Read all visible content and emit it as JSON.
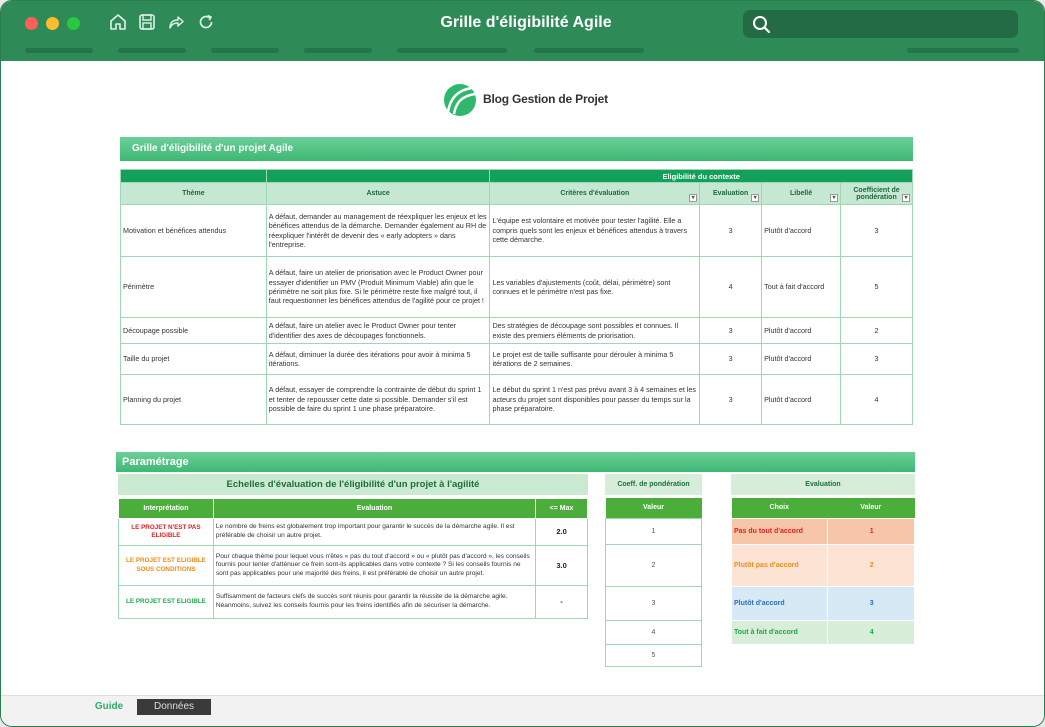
{
  "window": {
    "title": "Grille d'éligibilité Agile",
    "toolbar_icons": [
      "home-icon",
      "save-icon",
      "redo-icon",
      "refresh-icon"
    ],
    "search_placeholder": ""
  },
  "logo": {
    "text": "Blog Gestion de Projet"
  },
  "section1": {
    "title": "Grille d'éligibilité d'un projet Agile",
    "group_header": "Eligibilité du contexte",
    "columns": [
      "Thème",
      "Astuce",
      "Critères d'évaluation",
      "Evaluation",
      "Libellé",
      "Coefficient de pondération"
    ],
    "rows": [
      {
        "theme": "Motivation et bénéfices attendus",
        "astuce": "A défaut, demander au management de réexpliquer les enjeux et les bénéfices attendus de la démarche. Demander également au RH de réexpliquer l'intérêt de devenir des « early adopters » dans l'entreprise.",
        "critere": "L'équipe est volontaire et motivée pour tester l'agilité. Elle a compris quels sont les enjeux et bénéfices attendus à travers cette démarche.",
        "evaluation": "3",
        "libelle": "Plutôt d'accord",
        "coef": "3"
      },
      {
        "theme": "Périmètre",
        "astuce": "A défaut, faire un atelier de priorisation avec le Product Owner pour essayer d'identifier un PMV (Produit Minimum Viable) afin que le périmètre ne soit plus fixe. Si le périmètre reste fixe malgré tout, il faut requestionner les bénéfices attendus de l'agilité pour ce projet !",
        "critere": "Les variables d'ajustements (coût, délai, périmètre) sont connues et le périmètre n'est pas fixe.",
        "evaluation": "4",
        "libelle": "Tout à fait d'accord",
        "coef": "5"
      },
      {
        "theme": "Découpage possible",
        "astuce": "A défaut, faire un atelier avec le Product Owner pour tenter d'identifier des axes de découpages fonctionnels.",
        "critere": "Des stratégies de découpage sont possibles et connues. Il existe des premiers éléments de priorisation.",
        "evaluation": "3",
        "libelle": "Plutôt d'accord",
        "coef": "2"
      },
      {
        "theme": "Taille du projet",
        "astuce": "A défaut, diminuer la durée des itérations pour avoir à minima 5 itérations.",
        "critere": "Le projet est de taille suffisante pour dérouler à minima 5 itérations de 2 semaines.",
        "evaluation": "3",
        "libelle": "Plutôt d'accord",
        "coef": "3"
      },
      {
        "theme": "Planning du projet",
        "astuce": "A défaut, essayer de comprendre la contrainte de début du sprint 1 et tenter de repousser cette date si possible. Demander s'il est possible de faire du sprint 1 une phase préparatoire.",
        "critere": "Le début du sprint 1 n'est pas prévu avant 3 à 4 semaines et les acteurs du projet sont disponibles pour passer du temps sur la phase préparatoire.",
        "evaluation": "3",
        "libelle": "Plutôt d'accord",
        "coef": "4"
      }
    ]
  },
  "parametrage": {
    "title": "Paramétrage",
    "scales": {
      "title": "Echelles d'évaluation de l'éligibilité d'un projet à l'agilité",
      "columns": [
        "Interprétation",
        "Evaluation",
        "<= Max"
      ],
      "rows": [
        {
          "interpretation": "LE PROJET N'EST PAS ELIGIBLE",
          "color": "#e02020",
          "evaluation": "Le nombre de freins est globalement trop important pour garantir le succès de la démarche agile. Il est préférable de choisir un autre projet.",
          "max": "2.0"
        },
        {
          "interpretation": "LE PROJET EST ELIGIBLE SOUS CONDITIONS",
          "color": "#f08c1a",
          "evaluation": "Pour chaque thème pour lequel vous n'êtes « pas du tout d'accord » ou « plutôt pas d'accord », les conseils fournis pour tenter d'atténuer ce frein sont-ils applicables dans votre contexte ? Si les conseils fournis ne sont pas applicables pour une majorité des freins, il est préférable de choisir un autre projet.",
          "max": "3.0"
        },
        {
          "interpretation": "LE PROJET EST ELIGIBLE",
          "color": "#1fa84a",
          "evaluation": "Suffisamment de facteurs clefs de succès sont réunis pour garantir la réussite de la démarche agile. Néanmoins, suivez les conseils fournis pour les freins identifiés afin de sécuriser la démarche.",
          "max": "-"
        }
      ]
    },
    "coef": {
      "title": "Coeff. de pondération",
      "column": "Valeur",
      "values": [
        "1",
        "2",
        "3",
        "4",
        "5"
      ]
    },
    "evaluation": {
      "title": "Evaluation",
      "columns": [
        "Choix",
        "Valeur"
      ],
      "rows": [
        {
          "choix": "Pas du tout d'accord",
          "valeur": "1",
          "bg": "#f7c6a8",
          "color": "#e02020"
        },
        {
          "choix": "Plutôt pas d'accord",
          "valeur": "2",
          "bg": "#fde3d3",
          "color": "#f08c1a"
        },
        {
          "choix": "Plutôt d'accord",
          "valeur": "3",
          "bg": "#d6e9f5",
          "color": "#2a6fbf"
        },
        {
          "choix": "Tout à fait d'accord",
          "valeur": "4",
          "bg": "#d9eed9",
          "color": "#1fa84a"
        }
      ]
    }
  },
  "sheets": {
    "active": "Guide",
    "other": "Données"
  }
}
